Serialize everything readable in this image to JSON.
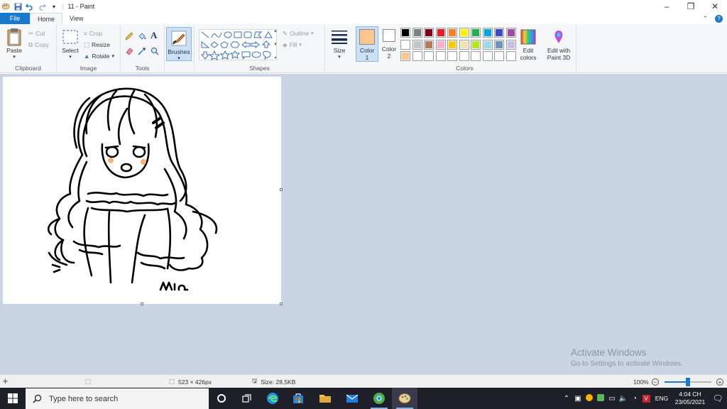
{
  "window": {
    "title": "11 - Paint",
    "controls": [
      "minimize",
      "restore",
      "close"
    ]
  },
  "tabs": {
    "file": "File",
    "home": "Home",
    "view": "View"
  },
  "ribbon": {
    "clipboard": {
      "paste": "Paste",
      "cut": "Cut",
      "copy": "Copy",
      "label": "Clipboard"
    },
    "image": {
      "select": "Select",
      "crop": "Crop",
      "resize": "Resize",
      "rotate": "Rotate",
      "label": "Image"
    },
    "tools": {
      "label": "Tools",
      "items": [
        "pencil-icon",
        "fill-icon",
        "text-icon",
        "eraser-icon",
        "color-picker-icon",
        "magnifier-icon"
      ]
    },
    "brushes": {
      "label": "Brushes"
    },
    "shapes": {
      "outline": "Outline",
      "fill": "Fill",
      "label": "Shapes"
    },
    "size": {
      "label": "Size"
    },
    "colors": {
      "color1": "Color\n1",
      "color1_label_a": "Color",
      "color1_label_b": "1",
      "color2_label_a": "Color",
      "color2_label_b": "2",
      "color1_value": "#fdc68c",
      "color2_value": "#ffffff",
      "edit_colors_a": "Edit",
      "edit_colors_b": "colors",
      "paint3d_a": "Edit with",
      "paint3d_b": "Paint 3D",
      "label": "Colors",
      "palette_row1": [
        "#000000",
        "#7f7f7f",
        "#880015",
        "#ed1c24",
        "#ff7f27",
        "#fff200",
        "#22b14c",
        "#00a2e8",
        "#3f48cc",
        "#a349a4"
      ],
      "palette_row2": [
        "#ffffff",
        "#c3c3c3",
        "#b97a57",
        "#ffaec9",
        "#ffc90e",
        "#efe4b0",
        "#b5e61d",
        "#99d9ea",
        "#7092be",
        "#c8bfe7"
      ],
      "palette_row3": [
        "#fdc68c",
        "#ffffff",
        "#ffffff",
        "#ffffff",
        "#ffffff",
        "#ffffff",
        "#ffffff",
        "#ffffff",
        "#ffffff",
        "#ffffff"
      ]
    }
  },
  "canvas": {
    "signature": "Mia"
  },
  "watermark": {
    "line1": "Activate Windows",
    "line2": "Go to Settings to activate Windows."
  },
  "statusbar": {
    "dimensions": "523 × 426px",
    "size": "Size: 28,5KB",
    "zoom": "100%",
    "zoom_level": 0.5
  },
  "taskbar": {
    "search_placeholder": "Type here to search",
    "language": "ENG",
    "time": "4:04 CH",
    "date": "23/05/2021"
  }
}
